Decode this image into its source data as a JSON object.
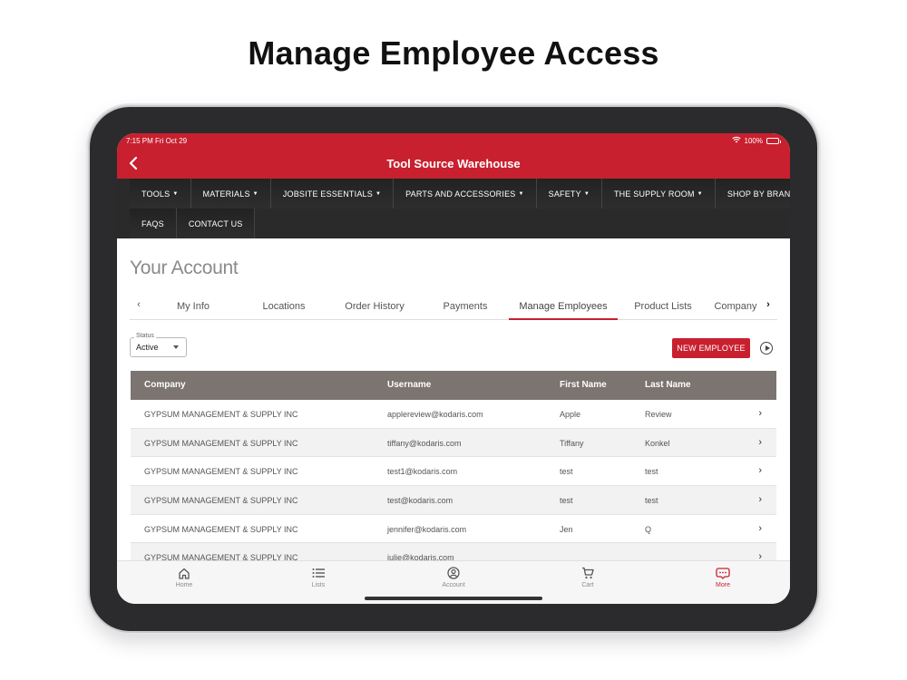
{
  "headline": "Manage Employee Access",
  "status_bar": {
    "time": "7:15 PM   Fri Oct 29",
    "battery": "100%"
  },
  "app_title": "Tool Source Warehouse",
  "nav_row1": [
    {
      "label": "TOOLS",
      "has_caret": true
    },
    {
      "label": "MATERIALS",
      "has_caret": true
    },
    {
      "label": "JOBSITE ESSENTIALS",
      "has_caret": true
    },
    {
      "label": "PARTS AND ACCESSORIES",
      "has_caret": true
    },
    {
      "label": "SAFETY",
      "has_caret": true
    },
    {
      "label": "THE SUPPLY ROOM",
      "has_caret": true
    },
    {
      "label": "SHOP BY BRAND",
      "has_caret": false
    }
  ],
  "nav_row2": [
    {
      "label": "FAQS",
      "has_caret": false
    },
    {
      "label": "CONTACT US",
      "has_caret": false
    }
  ],
  "page_title": "Your Account",
  "tabs": [
    {
      "label": "My Info",
      "active": false
    },
    {
      "label": "Locations",
      "active": false
    },
    {
      "label": "Order History",
      "active": false
    },
    {
      "label": "Payments",
      "active": false
    },
    {
      "label": "Manage Employees",
      "active": true
    },
    {
      "label": "Product Lists",
      "active": false
    },
    {
      "label": "Company",
      "active": false
    }
  ],
  "status_filter": {
    "label": "Status",
    "value": "Active"
  },
  "new_employee_label": "NEW EMPLOYEE",
  "table": {
    "columns": [
      "Company",
      "Username",
      "First Name",
      "Last Name"
    ],
    "rows": [
      [
        "GYPSUM MANAGEMENT & SUPPLY INC",
        "applereview@kodaris.com",
        "Apple",
        "Review"
      ],
      [
        "GYPSUM MANAGEMENT & SUPPLY INC",
        "tiffany@kodaris.com",
        "Tiffany",
        "Konkel"
      ],
      [
        "GYPSUM MANAGEMENT & SUPPLY INC",
        "test1@kodaris.com",
        "test",
        "test"
      ],
      [
        "GYPSUM MANAGEMENT & SUPPLY INC",
        "test@kodaris.com",
        "test",
        "test"
      ],
      [
        "GYPSUM MANAGEMENT & SUPPLY INC",
        "jennifer@kodaris.com",
        "Jen",
        "Q"
      ],
      [
        "GYPSUM MANAGEMENT & SUPPLY INC",
        "julie@kodaris.com",
        "",
        ""
      ]
    ]
  },
  "tab_bar": [
    {
      "label": "Home",
      "icon": "home-icon",
      "active": false
    },
    {
      "label": "Lists",
      "icon": "list-icon",
      "active": false
    },
    {
      "label": "Account",
      "icon": "account-icon",
      "active": false
    },
    {
      "label": "Cart",
      "icon": "cart-icon",
      "active": false
    },
    {
      "label": "More",
      "icon": "more-icon",
      "active": true
    }
  ],
  "colors": {
    "brand_red": "#c8202f",
    "nav_dark": "#2a2a2a",
    "table_header": "#7b7470"
  }
}
